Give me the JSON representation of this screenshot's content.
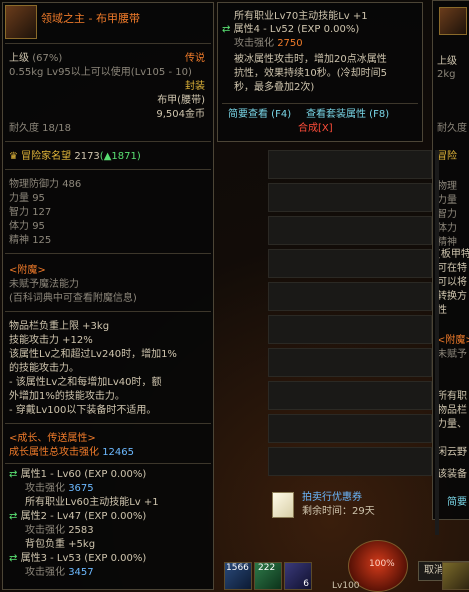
{
  "left_tooltip": {
    "item_name": "领域之主 - 布甲腰带",
    "grade": "上级",
    "grade_pct": "(67%)",
    "rarity": "传说",
    "weight_level": "0.55kg Lv95以上可以使用(Lv105 - 10)",
    "sealed": "封装",
    "item_type": "布甲(腰带)",
    "price": "9,504金币",
    "durability": "耐久度 18/18",
    "fame_label": "冒险家名望",
    "fame_value": "2173",
    "fame_change": "(▲1871)",
    "stats": [
      {
        "label": "物理防御力",
        "value": "486"
      },
      {
        "label": "力量",
        "value": "95"
      },
      {
        "label": "智力",
        "value": "127"
      },
      {
        "label": "体力",
        "value": "95"
      },
      {
        "label": "精神",
        "value": "125"
      }
    ],
    "enchant_title": "<附魔>",
    "enchant_line1": "未赋予魔法能力",
    "enchant_line2": "(百科词典中可查看附魔信息)",
    "effects": [
      "物品栏负重上限 +3kg",
      "技能攻击力 +12%",
      "该属性Lv之和超过Lv240时，增加1%",
      "的技能攻击力。",
      "- 该属性Lv之和每增加Lv40时，额",
      "外增加1%的技能攻击力。",
      "- 穿戴Lv100以下装备时不适用。"
    ],
    "growth_title": "<成长、传送属性>",
    "growth_total_label": "成长属性总攻击强化",
    "growth_total_value": "12465",
    "attr1": "属性1 - Lv60 (EXP 0.00%)",
    "attr1_atk_label": "攻击强化",
    "attr1_atk_value": "3675",
    "attr1_skill": "所有职业Lv60主动技能Lv +1",
    "attr2": "属性2 - Lv47 (EXP 0.00%)",
    "attr2_atk_label": "攻击强化",
    "attr2_atk_value": "2583",
    "attr2_bag": "背包负重 +5kg",
    "attr3": "属性3 - Lv53 (EXP 0.00%)",
    "attr3_atk_label": "攻击强化",
    "attr3_atk_value": "3457"
  },
  "top_tooltip": {
    "line1": "所有职业Lv70主动技能Lv +1",
    "attr4": "属性4 - Lv52 (EXP 0.00%)",
    "attr4_atk_label": "攻击强化",
    "attr4_atk_value": "2750",
    "effect1": "被冰属性攻击时，增加20点冰属性",
    "effect2": "抗性，效果持续10秒。(冷却时间5",
    "effect3": "秒，最多叠加2次)",
    "hint_brief": "简要查看 (F4)",
    "hint_set": "查看套装属性 (F8)",
    "hint_synth": "合成[X]"
  },
  "right_tooltip": {
    "grade": "上级",
    "weight": "2kg",
    "durability": "耐久度",
    "fame": "冒险",
    "stat1": "物理",
    "stat2": "力量",
    "stat3": "智力",
    "stat4": "体力",
    "stat5": "精神",
    "text1": "[板甲特",
    "text2": "可在特",
    "text3": "可以将",
    "text4": "转换方",
    "text5": "性",
    "enchant": "<附魔>",
    "enchant2": "未赋予",
    "text6": "所有职",
    "text7": "物品栏",
    "text8": "力量、",
    "text9": "闲云野",
    "text10": "该装备",
    "simple": "简要"
  },
  "auction": {
    "title": "拍卖行优惠券",
    "remaining_label": "剩余时间：",
    "remaining_value": "29天"
  },
  "buttons": {
    "cancel_listing": "取消上架"
  },
  "hotbar": {
    "slot1_count": "1566",
    "slot2_count": "222",
    "slot3_count": "6",
    "level_label": "Lv100",
    "hp_percent": "100%"
  }
}
